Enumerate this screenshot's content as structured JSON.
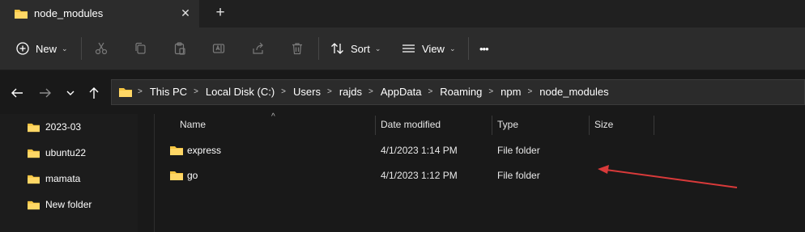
{
  "tab": {
    "title": "node_modules",
    "close": "✕",
    "new_tab": "+"
  },
  "toolbar": {
    "new_label": "New",
    "sort_label": "Sort",
    "view_label": "View",
    "more": "•••"
  },
  "address": {
    "crumbs": [
      "This PC",
      "Local Disk (C:)",
      "Users",
      "rajds",
      "AppData",
      "Roaming",
      "npm",
      "node_modules"
    ]
  },
  "nav_pane": {
    "items": [
      "2023-03",
      "ubuntu22",
      "mamata",
      "New folder"
    ]
  },
  "columns": {
    "name": "Name",
    "date": "Date modified",
    "type": "Type",
    "size": "Size"
  },
  "files": [
    {
      "name": "express",
      "date": "4/1/2023 1:14 PM",
      "type": "File folder",
      "size": ""
    },
    {
      "name": "go",
      "date": "4/1/2023 1:12 PM",
      "type": "File folder",
      "size": ""
    }
  ],
  "colors": {
    "folder": "#f5c542",
    "annotation_arrow": "#d93a3a",
    "accent": "#60cdff"
  }
}
